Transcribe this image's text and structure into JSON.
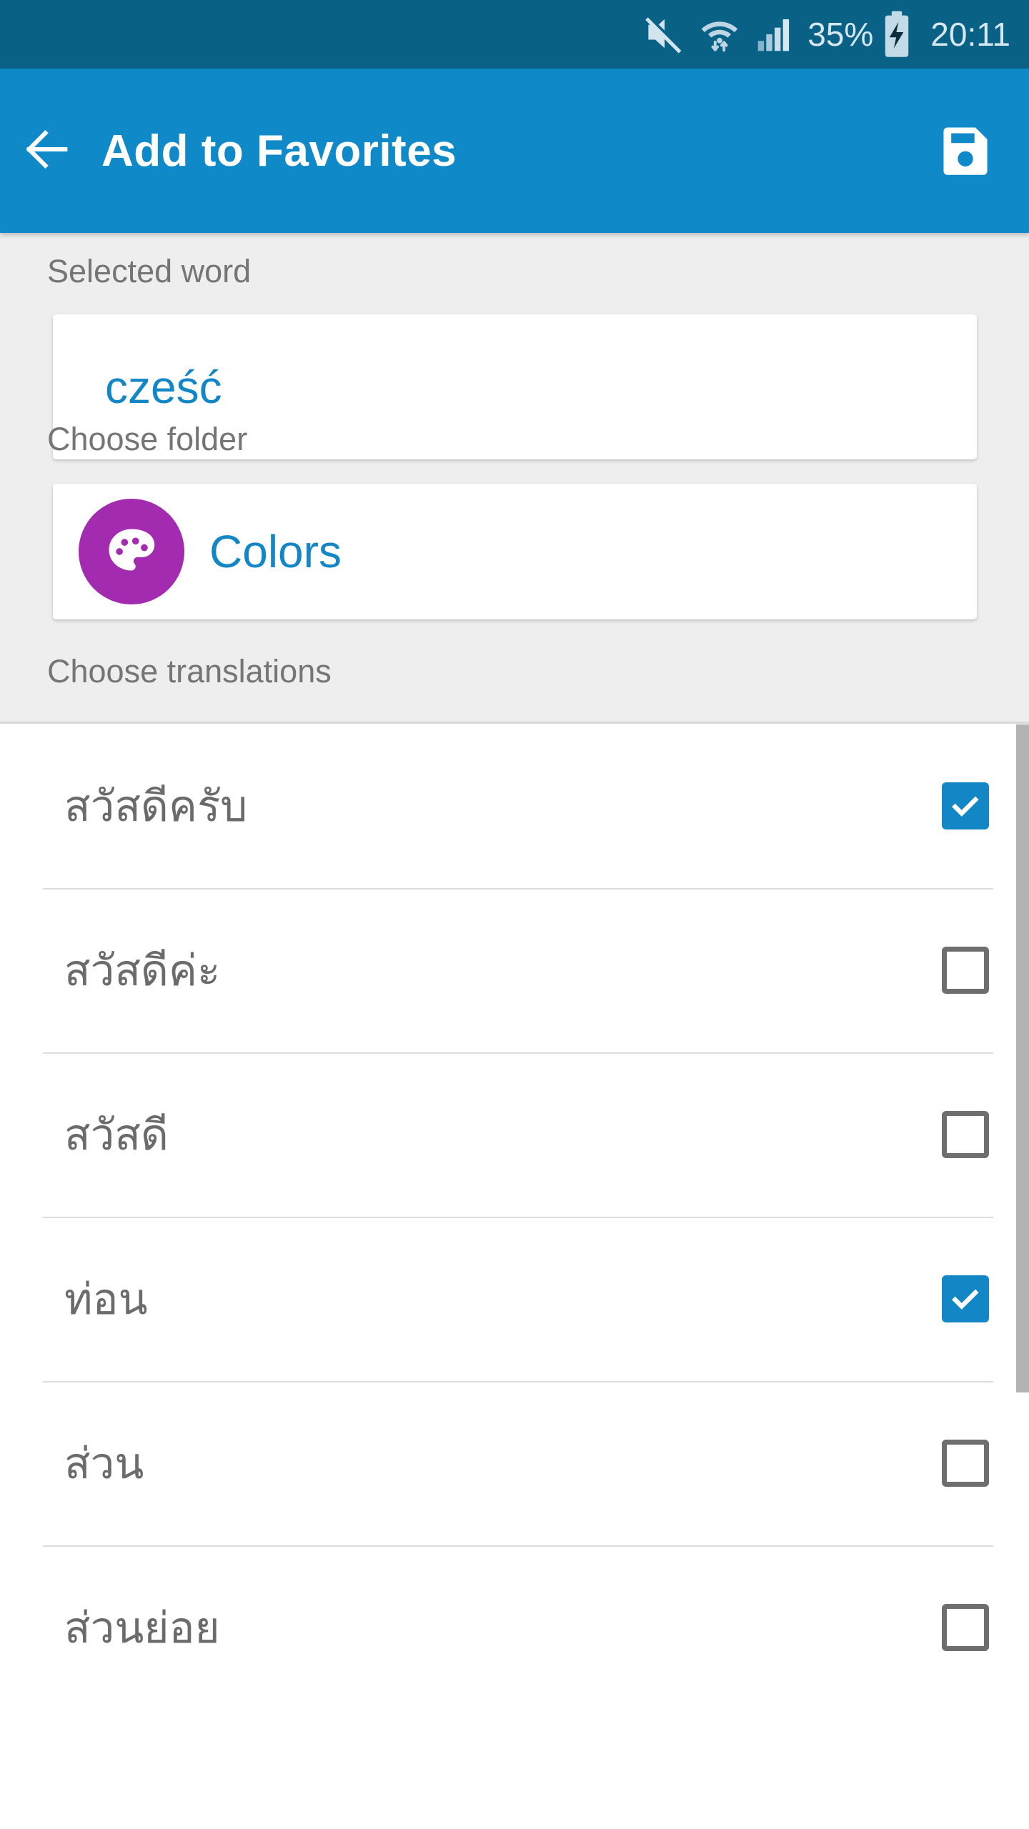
{
  "status_bar": {
    "battery_percent": "35%",
    "clock": "20:11",
    "icons": [
      "volume-mute-icon",
      "wifi-icon",
      "signal-bars-icon",
      "battery-charging-icon"
    ],
    "background_color": "#0a6186",
    "text_color": "#d7e7ef"
  },
  "app_bar": {
    "title": "Add to Favorites",
    "back_icon": "arrow-back-icon",
    "save_icon": "floppy-save-icon",
    "background_color": "#1089c8",
    "title_color": "#ffffff"
  },
  "selected_word": {
    "label": "Selected word",
    "value": "cześć",
    "value_color": "#1387c6"
  },
  "choose_folder": {
    "label": "Choose folder",
    "folder_name": "Colors",
    "folder_icon": "palette-icon",
    "folder_icon_color": "#a32bb0",
    "folder_name_color": "#1387c6"
  },
  "choose_translations": {
    "label": "Choose translations",
    "items": [
      {
        "text": "สวัสดีครับ",
        "checked": true
      },
      {
        "text": "สวัสดีค่ะ",
        "checked": false
      },
      {
        "text": "สวัสดี",
        "checked": false
      },
      {
        "text": "ท่อน",
        "checked": true
      },
      {
        "text": "ส่วน",
        "checked": false
      },
      {
        "text": "ส่วนย่อย",
        "checked": false
      }
    ],
    "checked_color": "#1387c6",
    "unchecked_border_color": "#6e6e6e"
  },
  "scrollbar": {
    "color": "#b3b3b3"
  }
}
